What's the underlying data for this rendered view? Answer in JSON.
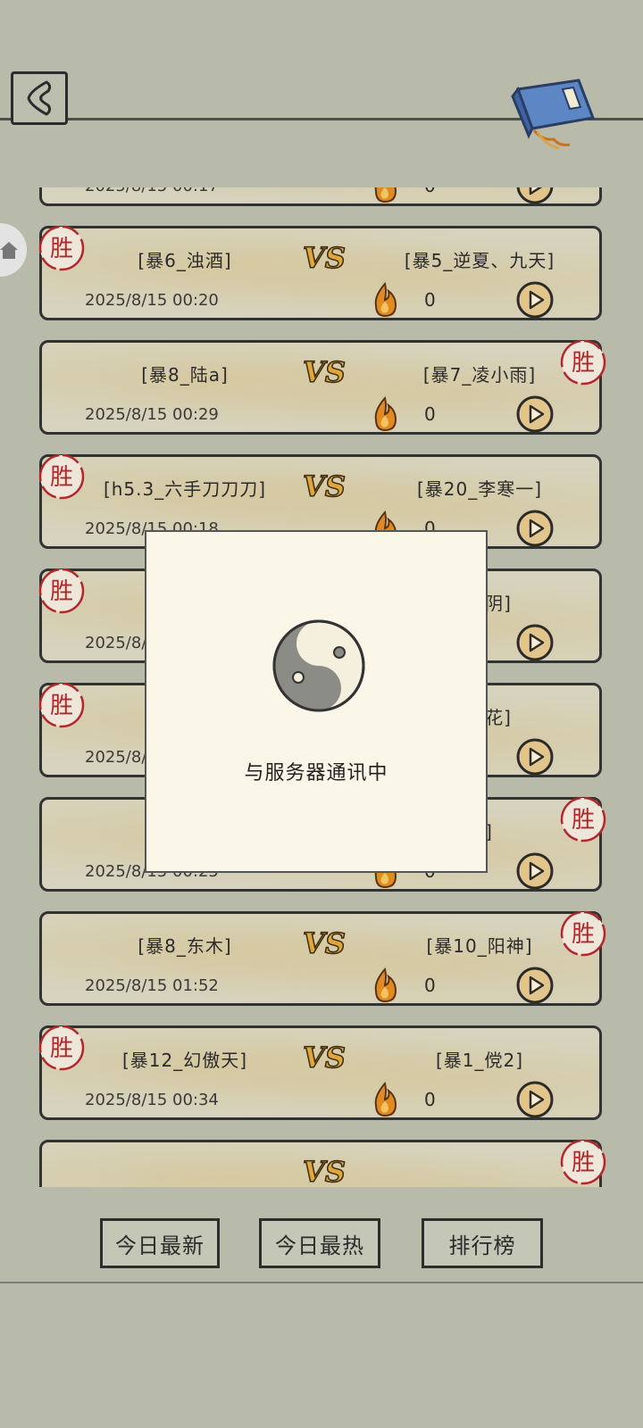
{
  "header": {
    "back_icon": "back-arrow-icon",
    "book_icon": "scroll-book-icon"
  },
  "matches": [
    {
      "p1": "",
      "p2": "",
      "date": "2025/8/15 00:17",
      "count": "0",
      "winner": ""
    },
    {
      "p1": "[暴6_浊酒]",
      "p2": "[暴5_逆夏、九天]",
      "date": "2025/8/15 00:20",
      "count": "0",
      "winner": "left"
    },
    {
      "p1": "[暴8_陆a]",
      "p2": "[暴7_凌小雨]",
      "date": "2025/8/15 00:29",
      "count": "0",
      "winner": "right"
    },
    {
      "p1": "[h5.3_六手刀刀刀]",
      "p2": "[暴20_李寒一]",
      "date": "2025/8/15 00:18",
      "count": "0",
      "winner": "left"
    },
    {
      "p1": "[暴",
      "p2": "烛九阴]",
      "date": "2025/8/",
      "count": "0",
      "winner": "left"
    },
    {
      "p1": "[暴1",
      "p2": "酒风花]",
      "date": "2025/8/",
      "count": "0",
      "winner": "left"
    },
    {
      "p1": "[暴",
      "p2": "童]",
      "date": "2025/8/15 00:25",
      "count": "0",
      "winner": "right"
    },
    {
      "p1": "[暴8_东木]",
      "p2": "[暴10_阳神]",
      "date": "2025/8/15 01:52",
      "count": "0",
      "winner": "right"
    },
    {
      "p1": "[暴12_幻傲天]",
      "p2": "[暴1_傥2]",
      "date": "2025/8/15 00:34",
      "count": "0",
      "winner": "left"
    },
    {
      "p1": "",
      "p2": "",
      "date": "",
      "count": "",
      "winner": "right"
    }
  ],
  "labels": {
    "vs": "VS",
    "win": "胜"
  },
  "modal": {
    "icon": "taiji-icon",
    "text": "与服务器通讯中"
  },
  "tabs": {
    "today_latest": "今日最新",
    "today_hot": "今日最热",
    "ranking": "排行榜"
  },
  "colors": {
    "background": "#b9bbaa",
    "card": "#d6d3be",
    "accent_orange": "#d07b1e",
    "win_red": "#b3262a",
    "modal_bg": "#faf6e8"
  }
}
